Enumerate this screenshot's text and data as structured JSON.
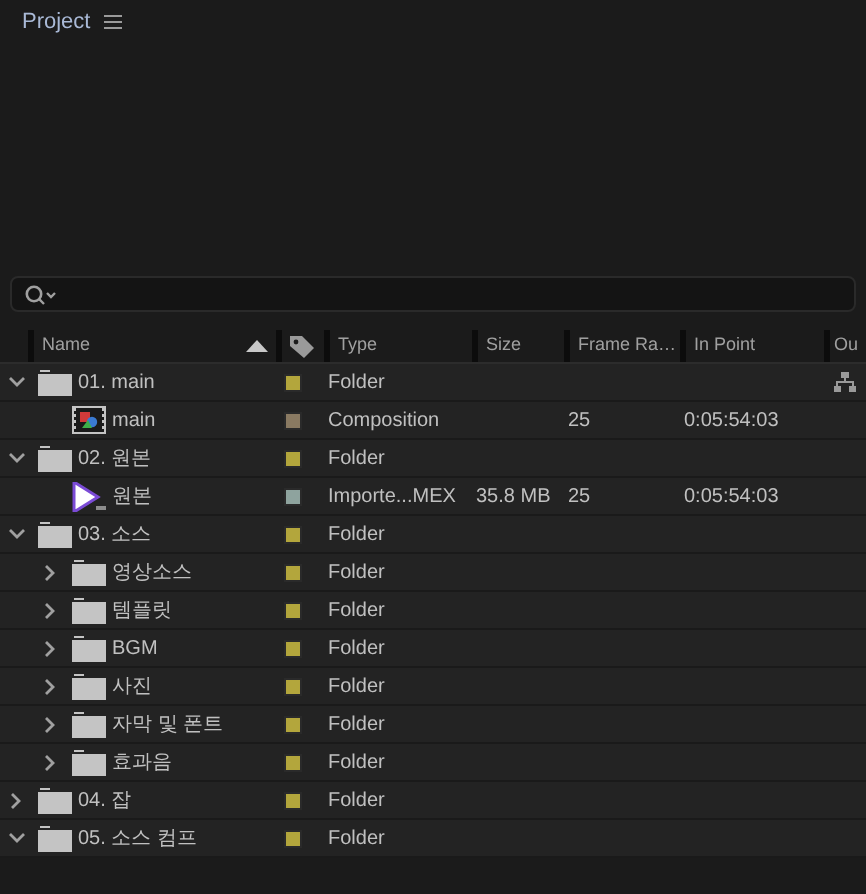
{
  "panel": {
    "title": "Project"
  },
  "columns": [
    {
      "label": "Name",
      "sorted": true
    },
    {},
    {
      "label": "Type"
    },
    {
      "label": "Size"
    },
    {
      "label": "Frame Ra…"
    },
    {
      "label": "In Point"
    },
    {
      "label": "Ou"
    }
  ],
  "items": [
    {
      "name": "01. main",
      "kind": "folder",
      "expanded": true,
      "color": "#b3a63c",
      "type": "Folder",
      "children": [
        {
          "name": "main",
          "kind": "composition",
          "color": "#8a7a62",
          "type": "Composition",
          "frame_rate": "25",
          "in_point": "0:05:54:03"
        }
      ]
    },
    {
      "name": "02. 원본",
      "kind": "folder",
      "expanded": true,
      "color": "#b3a63c",
      "type": "Folder",
      "children": [
        {
          "name": "원본",
          "kind": "footage",
          "color": "#8ea39e",
          "type": "Importe...MEX",
          "size": "35.8 MB",
          "frame_rate": "25",
          "in_point": "0:05:54:03"
        }
      ]
    },
    {
      "name": "03. 소스",
      "kind": "folder",
      "expanded": true,
      "color": "#b3a63c",
      "type": "Folder",
      "children": [
        {
          "name": "영상소스",
          "kind": "folder",
          "expanded": false,
          "color": "#b3a63c",
          "type": "Folder"
        },
        {
          "name": "템플릿",
          "kind": "folder",
          "expanded": false,
          "color": "#b3a63c",
          "type": "Folder"
        },
        {
          "name": "BGM",
          "kind": "folder",
          "expanded": false,
          "color": "#b3a63c",
          "type": "Folder"
        },
        {
          "name": "사진",
          "kind": "folder",
          "expanded": false,
          "color": "#b3a63c",
          "type": "Folder"
        },
        {
          "name": "자막 및 폰트",
          "kind": "folder",
          "expanded": false,
          "color": "#b3a63c",
          "type": "Folder"
        },
        {
          "name": "효과음",
          "kind": "folder",
          "expanded": false,
          "color": "#b3a63c",
          "type": "Folder"
        }
      ]
    },
    {
      "name": "04. 잡",
      "kind": "folder",
      "expanded": false,
      "color": "#b3a63c",
      "type": "Folder"
    },
    {
      "name": "05. 소스 컴프",
      "kind": "folder",
      "expanded": true,
      "color": "#b3a63c",
      "type": "Folder"
    }
  ]
}
